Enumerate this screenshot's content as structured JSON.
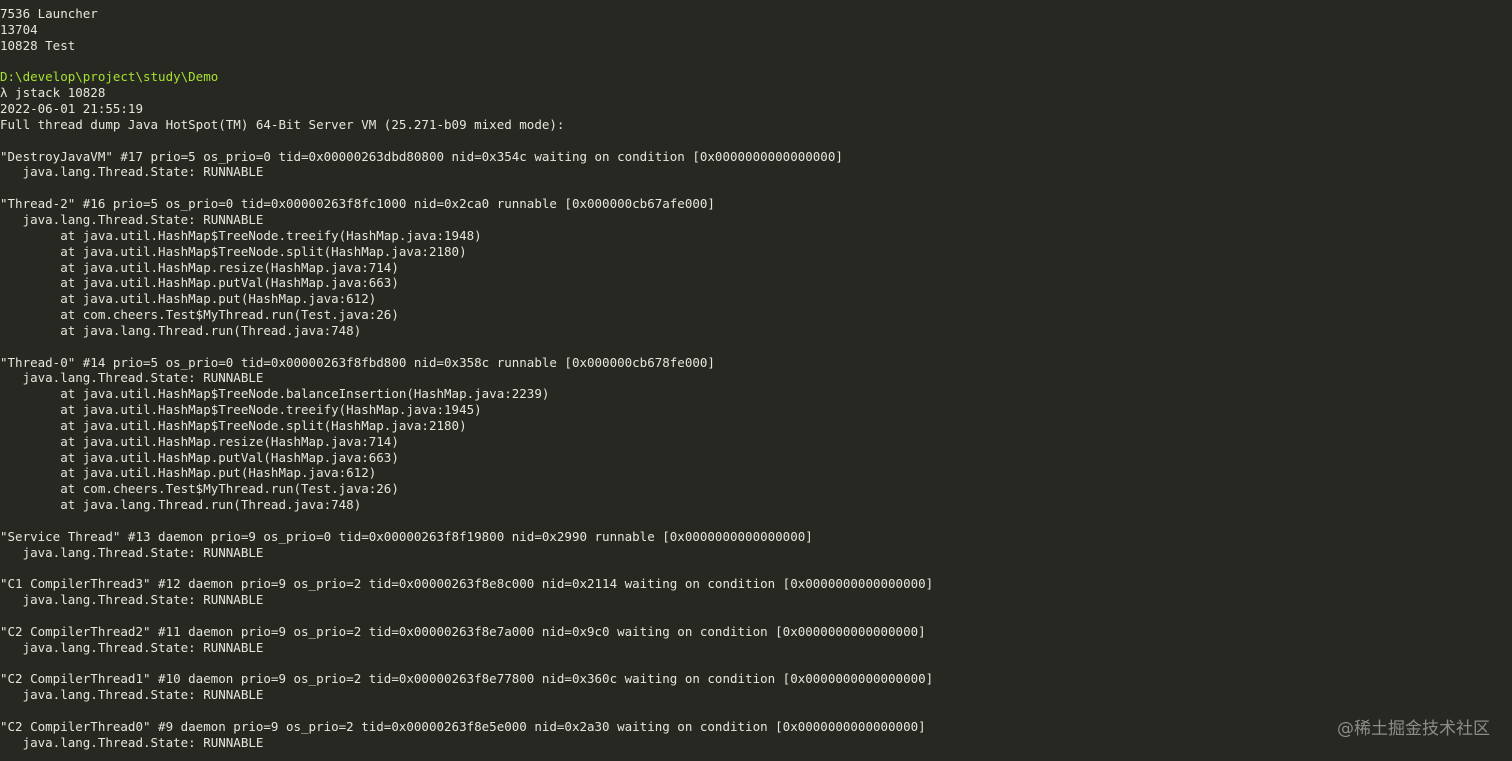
{
  "colors": {
    "background": "#272822",
    "text": "#e6e6dc",
    "path_text": "#a6e22e",
    "watermark": "#8c8c8c"
  },
  "terminal": {
    "lines": [
      "7536 Launcher",
      "13704",
      "10828 Test",
      "",
      "D:\\develop\\project\\study\\Demo",
      "λ jstack 10828",
      "2022-06-01 21:55:19",
      "Full thread dump Java HotSpot(TM) 64-Bit Server VM (25.271-b09 mixed mode):",
      "",
      "\"DestroyJavaVM\" #17 prio=5 os_prio=0 tid=0x00000263dbd80800 nid=0x354c waiting on condition [0x0000000000000000]",
      "   java.lang.Thread.State: RUNNABLE",
      "",
      "\"Thread-2\" #16 prio=5 os_prio=0 tid=0x00000263f8fc1000 nid=0x2ca0 runnable [0x000000cb67afe000]",
      "   java.lang.Thread.State: RUNNABLE",
      "        at java.util.HashMap$TreeNode.treeify(HashMap.java:1948)",
      "        at java.util.HashMap$TreeNode.split(HashMap.java:2180)",
      "        at java.util.HashMap.resize(HashMap.java:714)",
      "        at java.util.HashMap.putVal(HashMap.java:663)",
      "        at java.util.HashMap.put(HashMap.java:612)",
      "        at com.cheers.Test$MyThread.run(Test.java:26)",
      "        at java.lang.Thread.run(Thread.java:748)",
      "",
      "\"Thread-0\" #14 prio=5 os_prio=0 tid=0x00000263f8fbd800 nid=0x358c runnable [0x000000cb678fe000]",
      "   java.lang.Thread.State: RUNNABLE",
      "        at java.util.HashMap$TreeNode.balanceInsertion(HashMap.java:2239)",
      "        at java.util.HashMap$TreeNode.treeify(HashMap.java:1945)",
      "        at java.util.HashMap$TreeNode.split(HashMap.java:2180)",
      "        at java.util.HashMap.resize(HashMap.java:714)",
      "        at java.util.HashMap.putVal(HashMap.java:663)",
      "        at java.util.HashMap.put(HashMap.java:612)",
      "        at com.cheers.Test$MyThread.run(Test.java:26)",
      "        at java.lang.Thread.run(Thread.java:748)",
      "",
      "\"Service Thread\" #13 daemon prio=9 os_prio=0 tid=0x00000263f8f19800 nid=0x2990 runnable [0x0000000000000000]",
      "   java.lang.Thread.State: RUNNABLE",
      "",
      "\"C1 CompilerThread3\" #12 daemon prio=9 os_prio=2 tid=0x00000263f8e8c000 nid=0x2114 waiting on condition [0x0000000000000000]",
      "   java.lang.Thread.State: RUNNABLE",
      "",
      "\"C2 CompilerThread2\" #11 daemon prio=9 os_prio=2 tid=0x00000263f8e7a000 nid=0x9c0 waiting on condition [0x0000000000000000]",
      "   java.lang.Thread.State: RUNNABLE",
      "",
      "\"C2 CompilerThread1\" #10 daemon prio=9 os_prio=2 tid=0x00000263f8e77800 nid=0x360c waiting on condition [0x0000000000000000]",
      "   java.lang.Thread.State: RUNNABLE",
      "",
      "\"C2 CompilerThread0\" #9 daemon prio=9 os_prio=2 tid=0x00000263f8e5e000 nid=0x2a30 waiting on condition [0x0000000000000000]",
      "   java.lang.Thread.State: RUNNABLE"
    ],
    "highlight_line_index": 4
  },
  "watermark": {
    "text": "@稀土掘金技术社区"
  }
}
